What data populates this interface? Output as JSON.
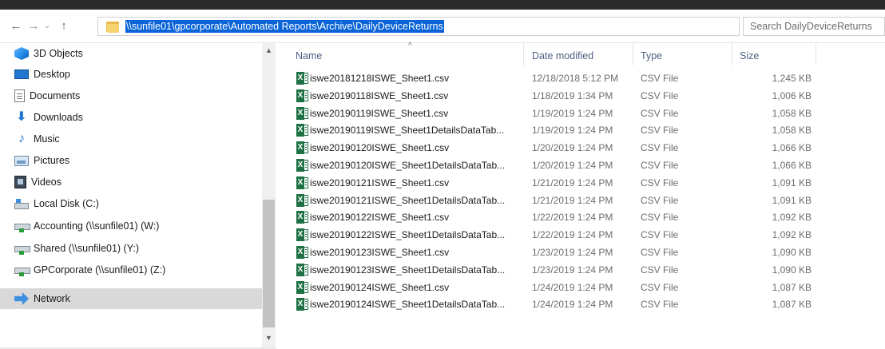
{
  "address": {
    "path": "\\\\sunfile01\\gpcorporate\\Automated Reports\\Archive\\DailyDeviceReturns",
    "dropdown_glyph": "⌄",
    "refresh_glyph": "↻"
  },
  "nav_buttons": {
    "back": "←",
    "forward": "→",
    "recent": "⌄",
    "up": "↑"
  },
  "search": {
    "placeholder": "Search DailyDeviceReturns"
  },
  "sidebar": {
    "items": [
      {
        "label": "3D Objects",
        "icon": "cube-3d-icon"
      },
      {
        "label": "Desktop",
        "icon": "desktop-icon"
      },
      {
        "label": "Documents",
        "icon": "documents-icon"
      },
      {
        "label": "Downloads",
        "icon": "downloads-icon"
      },
      {
        "label": "Music",
        "icon": "music-icon"
      },
      {
        "label": "Pictures",
        "icon": "pictures-icon"
      },
      {
        "label": "Videos",
        "icon": "videos-icon"
      },
      {
        "label": "Local Disk (C:)",
        "icon": "local-disk-icon"
      },
      {
        "label": "Accounting (\\\\sunfile01) (W:)",
        "icon": "network-drive-icon"
      },
      {
        "label": "Shared (\\\\sunfile01) (Y:)",
        "icon": "network-drive-icon"
      },
      {
        "label": "GPCorporate (\\\\sunfile01) (Z:)",
        "icon": "network-drive-icon"
      },
      {
        "label": "Network",
        "icon": "network-icon",
        "selected": true
      }
    ]
  },
  "columns": {
    "name": "Name",
    "date": "Date modified",
    "type": "Type",
    "size": "Size"
  },
  "files": [
    {
      "name": "iswe20181218ISWE_Sheet1.csv",
      "date": "12/18/2018 5:12 PM",
      "type": "CSV File",
      "size": "1,245 KB"
    },
    {
      "name": "iswe20190118ISWE_Sheet1.csv",
      "date": "1/18/2019 1:34 PM",
      "type": "CSV File",
      "size": "1,006 KB"
    },
    {
      "name": "iswe20190119ISWE_Sheet1.csv",
      "date": "1/19/2019 1:24 PM",
      "type": "CSV File",
      "size": "1,058 KB"
    },
    {
      "name": "iswe20190119ISWE_Sheet1DetailsDataTab...",
      "date": "1/19/2019 1:24 PM",
      "type": "CSV File",
      "size": "1,058 KB"
    },
    {
      "name": "iswe20190120ISWE_Sheet1.csv",
      "date": "1/20/2019 1:24 PM",
      "type": "CSV File",
      "size": "1,066 KB"
    },
    {
      "name": "iswe20190120ISWE_Sheet1DetailsDataTab...",
      "date": "1/20/2019 1:24 PM",
      "type": "CSV File",
      "size": "1,066 KB"
    },
    {
      "name": "iswe20190121ISWE_Sheet1.csv",
      "date": "1/21/2019 1:24 PM",
      "type": "CSV File",
      "size": "1,091 KB"
    },
    {
      "name": "iswe20190121ISWE_Sheet1DetailsDataTab...",
      "date": "1/21/2019 1:24 PM",
      "type": "CSV File",
      "size": "1,091 KB"
    },
    {
      "name": "iswe20190122ISWE_Sheet1.csv",
      "date": "1/22/2019 1:24 PM",
      "type": "CSV File",
      "size": "1,092 KB"
    },
    {
      "name": "iswe20190122ISWE_Sheet1DetailsDataTab...",
      "date": "1/22/2019 1:24 PM",
      "type": "CSV File",
      "size": "1,092 KB"
    },
    {
      "name": "iswe20190123ISWE_Sheet1.csv",
      "date": "1/23/2019 1:24 PM",
      "type": "CSV File",
      "size": "1,090 KB"
    },
    {
      "name": "iswe20190123ISWE_Sheet1DetailsDataTab...",
      "date": "1/23/2019 1:24 PM",
      "type": "CSV File",
      "size": "1,090 KB"
    },
    {
      "name": "iswe20190124ISWE_Sheet1.csv",
      "date": "1/24/2019 1:24 PM",
      "type": "CSV File",
      "size": "1,087 KB"
    },
    {
      "name": "iswe20190124ISWE_Sheet1DetailsDataTab...",
      "date": "1/24/2019 1:24 PM",
      "type": "CSV File",
      "size": "1,087 KB"
    }
  ],
  "colors": {
    "selection": "#0a64d8",
    "excel_green": "#1e7145",
    "header_text": "#4d6082"
  }
}
